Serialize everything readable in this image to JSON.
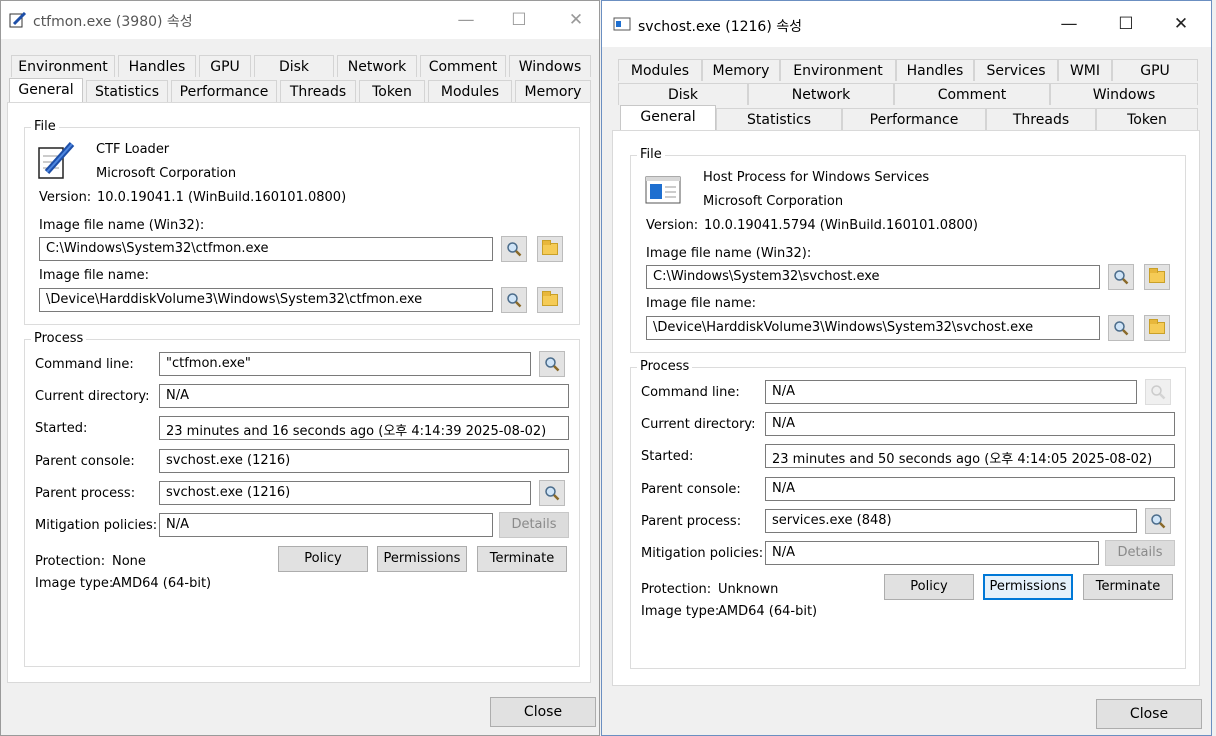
{
  "left": {
    "title": "ctfmon.exe (3980) 속성",
    "caption": {
      "min": "—",
      "max": "☐",
      "close": "✕"
    },
    "tabs_row1": [
      "Environment",
      "Handles",
      "GPU",
      "Disk",
      "Network",
      "Comment",
      "Windows"
    ],
    "tabs_row2": [
      "General",
      "Statistics",
      "Performance",
      "Threads",
      "Token",
      "Modules",
      "Memory"
    ],
    "file": {
      "group_label": "File",
      "description": "CTF Loader",
      "company": "Microsoft Corporation",
      "version_label": "Version:",
      "version": "10.0.19041.1 (WinBuild.160101.0800)",
      "image_win32_label": "Image file name (Win32):",
      "image_win32": "C:\\Windows\\System32\\ctfmon.exe",
      "image_label": "Image file name:",
      "image": "\\Device\\HarddiskVolume3\\Windows\\System32\\ctfmon.exe"
    },
    "process": {
      "group_label": "Process",
      "cmd_label": "Command line:",
      "cmd": "\"ctfmon.exe\"",
      "cwd_label": "Current directory:",
      "cwd": "N/A",
      "started_label": "Started:",
      "started": "23 minutes and 16 seconds ago (오후 4:14:39 2025-08-02)",
      "console_label": "Parent console:",
      "console": "svchost.exe (1216)",
      "parent_label": "Parent process:",
      "parent": "svchost.exe (1216)",
      "mitig_label": "Mitigation policies:",
      "mitig": "N/A",
      "details": "Details",
      "protection_label": "Protection:",
      "protection": "None",
      "image_type_label": "Image type:",
      "image_type": "AMD64 (64-bit)",
      "policy": "Policy",
      "permissions": "Permissions",
      "terminate": "Terminate"
    },
    "close": "Close"
  },
  "right": {
    "title": "svchost.exe (1216) 속성",
    "caption": {
      "min": "—",
      "max": "☐",
      "close": "✕"
    },
    "tabs_row1": [
      "Modules",
      "Memory",
      "Environment",
      "Handles",
      "Services",
      "WMI",
      "GPU"
    ],
    "tabs_row2": [
      "Disk",
      "Network",
      "Comment",
      "Windows"
    ],
    "tabs_row3": [
      "General",
      "Statistics",
      "Performance",
      "Threads",
      "Token"
    ],
    "file": {
      "group_label": "File",
      "description": "Host Process for Windows Services",
      "company": "Microsoft Corporation",
      "version_label": "Version:",
      "version": "10.0.19041.5794 (WinBuild.160101.0800)",
      "image_win32_label": "Image file name (Win32):",
      "image_win32": "C:\\Windows\\System32\\svchost.exe",
      "image_label": "Image file name:",
      "image": "\\Device\\HarddiskVolume3\\Windows\\System32\\svchost.exe"
    },
    "process": {
      "group_label": "Process",
      "cmd_label": "Command line:",
      "cmd": "N/A",
      "cwd_label": "Current directory:",
      "cwd": "N/A",
      "started_label": "Started:",
      "started": "23 minutes and 50 seconds ago (오후 4:14:05 2025-08-02)",
      "console_label": "Parent console:",
      "console": "N/A",
      "parent_label": "Parent process:",
      "parent": "services.exe (848)",
      "mitig_label": "Mitigation policies:",
      "mitig": "N/A",
      "details": "Details",
      "protection_label": "Protection:",
      "protection": "Unknown",
      "image_type_label": "Image type:",
      "image_type": "AMD64 (64-bit)",
      "policy": "Policy",
      "permissions": "Permissions",
      "terminate": "Terminate"
    },
    "close": "Close"
  },
  "colors": {
    "accent": "#0078d7",
    "folder": "#f5cb56",
    "window_bg": "#f0f0f0"
  }
}
